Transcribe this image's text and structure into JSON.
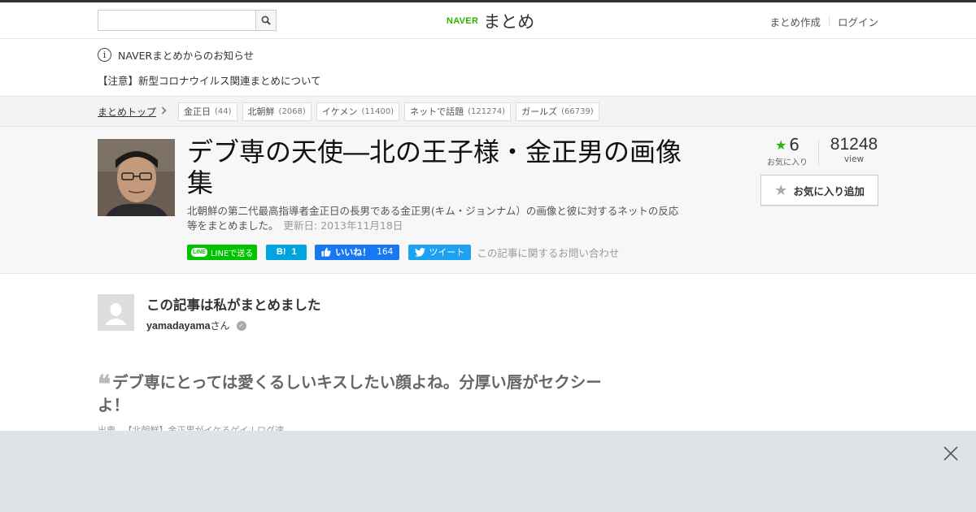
{
  "header": {
    "search": {
      "placeholder": "",
      "value": ""
    },
    "logo": {
      "brand": "NAVER",
      "name": "まとめ"
    },
    "links": {
      "create": "まとめ作成",
      "login": "ログイン"
    }
  },
  "notice": {
    "title": "NAVERまとめからのお知らせ",
    "item": "【注意】新型コロナウイルス関連まとめについて"
  },
  "breadcrumb": {
    "home": "まとめトップ",
    "tags": [
      {
        "label": "金正日",
        "count": "(44)"
      },
      {
        "label": "北朝鮮",
        "count": "(2068)"
      },
      {
        "label": "イケメン",
        "count": "(11400)"
      },
      {
        "label": "ネットで話題",
        "count": "(121274)"
      },
      {
        "label": "ガールズ",
        "count": "(66739)"
      }
    ]
  },
  "article": {
    "title": "デブ専の天使―北の王子様・金正男の画像集",
    "description": "北朝鮮の第二代最高指導者金正日の長男である金正男(キム・ジョンナム）の画像と彼に対するネットの反応等をまとめました。",
    "updated": "更新日: 2013年11月18日",
    "favorites": {
      "count": "6",
      "label": "お気に入り"
    },
    "views": {
      "count": "81248",
      "label": "view"
    },
    "fav_button": "お気に入り追加",
    "share": {
      "line": "LINEで送る",
      "hatena_icon": "B!",
      "hatena_count": "1",
      "fb_label": "いいね！",
      "fb_count": "164",
      "tweet": "ツイート",
      "contact": "この記事に関するお問い合わせ"
    }
  },
  "author": {
    "lead": "この記事は私がまとめました",
    "name": "yamadayama",
    "suffix": "さん"
  },
  "quote": {
    "text": "デブ専にとっては愛くるしいキスしたい顔よね。分厚い唇がセクシーよ！",
    "source_label": "出典",
    "source_link": "【北朝鮮】金正男がイケるゲイ | ログ速"
  },
  "colors": {
    "naver_green": "#2db400",
    "line_green": "#00c300",
    "hatena_blue": "#00a4de",
    "facebook_blue": "#1877f2",
    "twitter_blue": "#1da1f2"
  }
}
